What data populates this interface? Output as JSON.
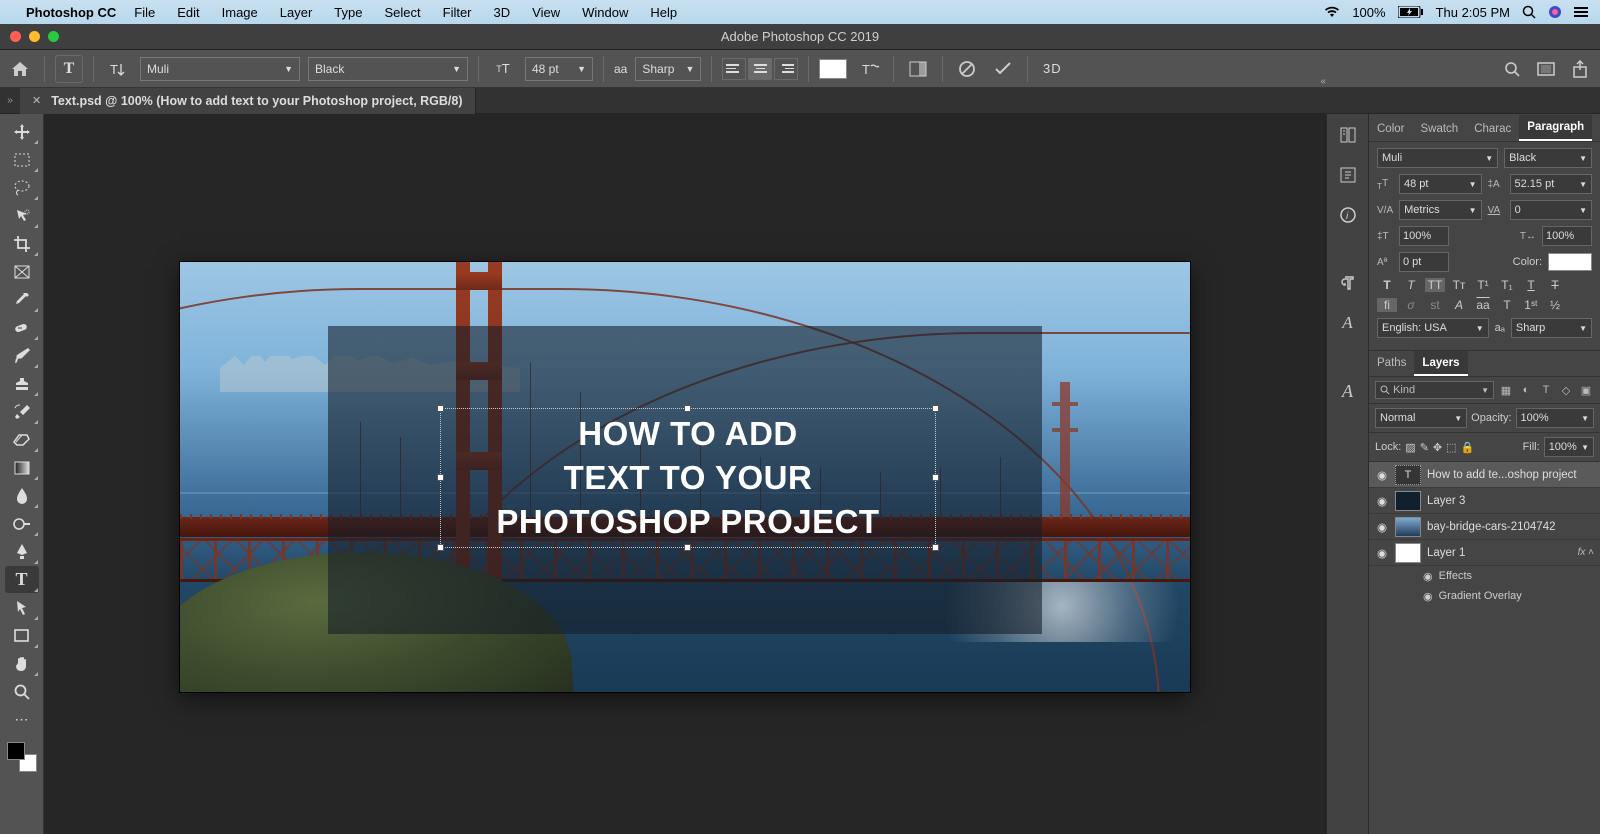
{
  "menubar": {
    "app": "Photoshop CC",
    "items": [
      "File",
      "Edit",
      "Image",
      "Layer",
      "Type",
      "Select",
      "Filter",
      "3D",
      "View",
      "Window",
      "Help"
    ],
    "battery": "100%",
    "clock": "Thu 2:05 PM"
  },
  "titlebar": {
    "title": "Adobe Photoshop CC 2019"
  },
  "options": {
    "font_family": "Muli",
    "font_style": "Black",
    "font_size": "48 pt",
    "aa_label": "aa",
    "antialias": "Sharp",
    "threeD": "3D"
  },
  "doc_tab": {
    "label": "Text.psd @ 100% (How to add  text to your  Photoshop project, RGB/8)"
  },
  "canvas": {
    "text_line1": "HOW TO ADD",
    "text_line2": "TEXT TO YOUR",
    "text_line3": "PHOTOSHOP PROJECT"
  },
  "char_tabs": [
    "Color",
    "Swatch",
    "Charac",
    "Paragraph"
  ],
  "char": {
    "font_family": "Muli",
    "font_style": "Black",
    "size": "48 pt",
    "leading": "52.15 pt",
    "kerning": "Metrics",
    "tracking": "0",
    "hscale": "100%",
    "vscale": "100%",
    "baseline": "0 pt",
    "color_label": "Color:",
    "lang": "English: USA",
    "aa": "Sharp"
  },
  "layers_tabs": [
    "Paths",
    "Layers"
  ],
  "layers_panel": {
    "kind_placeholder": "Kind",
    "blend": "Normal",
    "opacity_label": "Opacity:",
    "opacity": "100%",
    "lock_label": "Lock:",
    "fill_label": "Fill:",
    "fill": "100%"
  },
  "layers": [
    {
      "name": "How to add  te...oshop project",
      "type": "text",
      "selected": true
    },
    {
      "name": "Layer 3",
      "type": "raster"
    },
    {
      "name": "bay-bridge-cars-2104742",
      "type": "image"
    },
    {
      "name": "Layer 1",
      "type": "raster",
      "fx": true
    }
  ],
  "layer_fx": {
    "effects": "Effects",
    "item": "Gradient Overlay"
  }
}
